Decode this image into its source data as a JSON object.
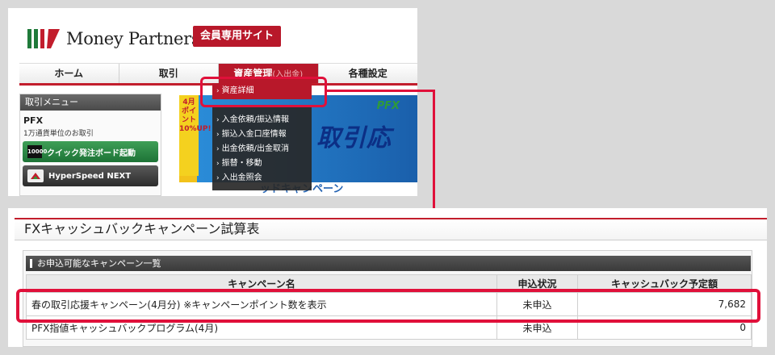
{
  "header": {
    "logo_text": "Money Partners",
    "member_badge": "会員専用サイト"
  },
  "nav": {
    "items": [
      {
        "label": "ホーム"
      },
      {
        "label": "取引"
      },
      {
        "label": "資産管理",
        "sub": "(入出金)"
      },
      {
        "label": "各種設定"
      }
    ]
  },
  "side_menu": {
    "header": "取引メニュー",
    "title": "PFX",
    "desc": "1万通貨単位のお取引",
    "btn_quick": "クイック発注ボード起動",
    "btn_quick_icon": "10000",
    "btn_hyper": "HyperSpeed NEXT"
  },
  "banner": {
    "badge": "4月ポイント10%UP!",
    "pfx": "PFX",
    "big": "取引応",
    "strip": "ッドキャンペーン"
  },
  "dropdown": {
    "items": [
      "資産詳細",
      "入金依頼/振込情報",
      "振込入金口座情報",
      "出金依頼/出金取消",
      "振替・移動",
      "入出金照会"
    ]
  },
  "page": {
    "title": "FXキャッシュバックキャンペーン試算表",
    "section_title": "お申込可能なキャンペーン一覧",
    "columns": [
      "キャンペーン名",
      "申込状況",
      "キャッシュバック予定額"
    ],
    "rows": [
      {
        "name": "春の取引応援キャンペーン(4月分) ※キャンペーンポイント数を表示",
        "status": "未申込",
        "amount": "7,682"
      },
      {
        "name": "PFX指値キャッシュバックプログラム(4月)",
        "status": "未申込",
        "amount": "0"
      }
    ]
  },
  "colors": {
    "brand_red": "#b8182a",
    "callout": "#e0103a"
  }
}
